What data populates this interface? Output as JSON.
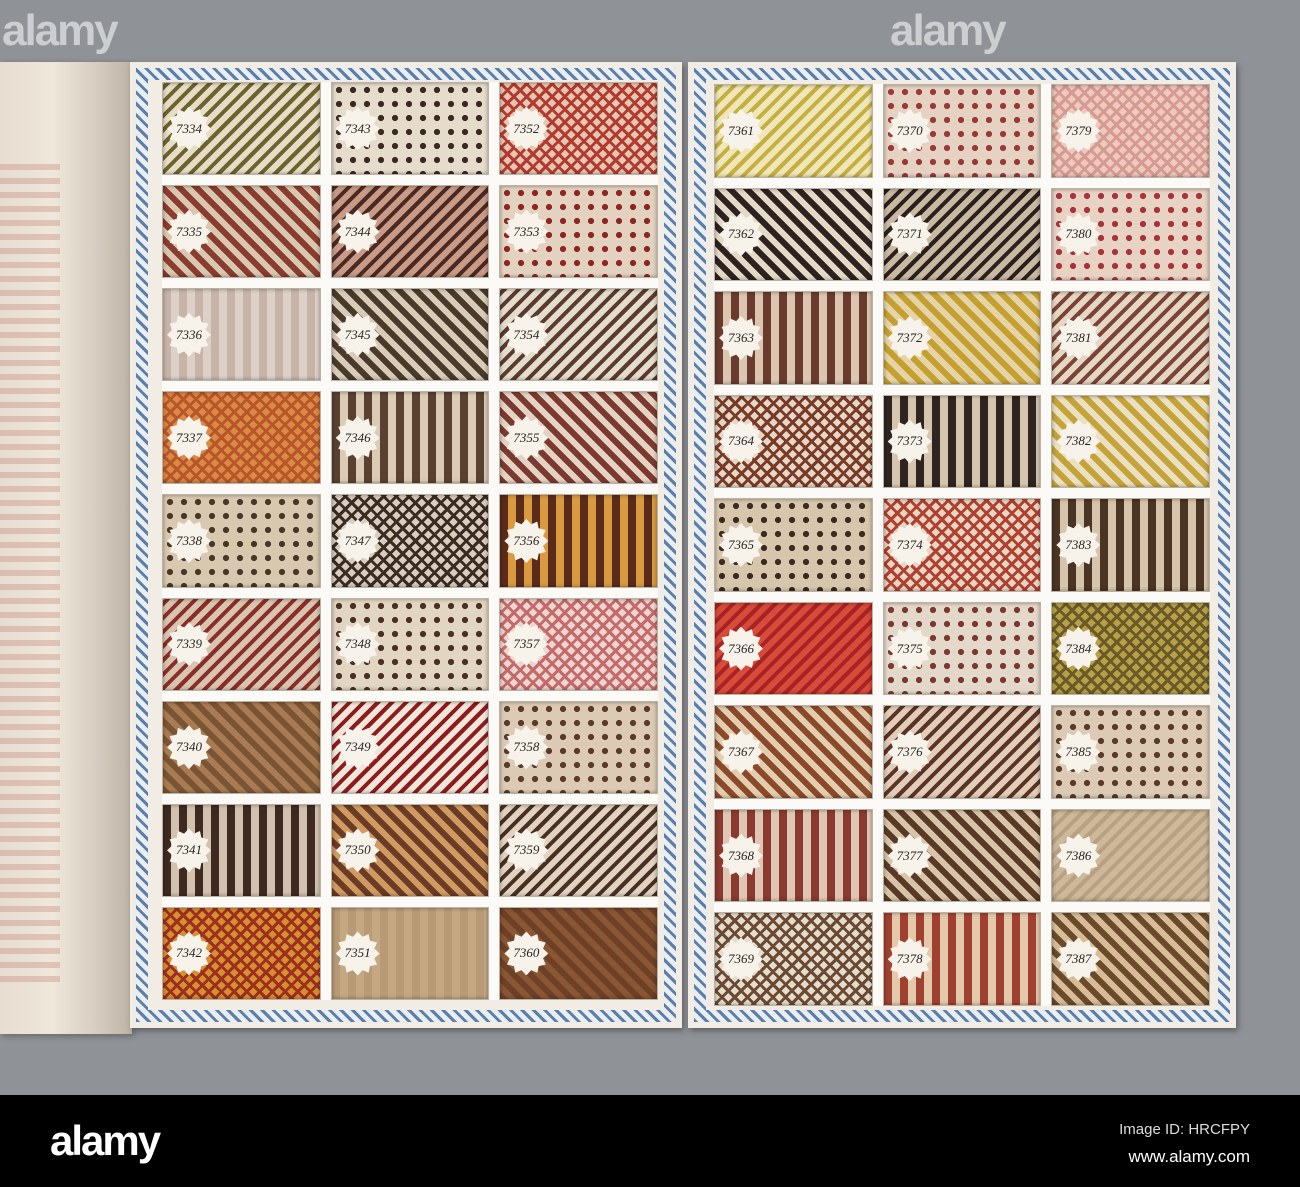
{
  "watermarks": [
    "alamy",
    "alamy"
  ],
  "left_page": {
    "numbers": [
      "7334",
      "7335",
      "7336",
      "7337",
      "7338",
      "7339",
      "7340",
      "7341",
      "7342",
      "7343",
      "7344",
      "7345",
      "7346",
      "7347",
      "7348",
      "7349",
      "7350",
      "7351",
      "7352",
      "7353",
      "7354",
      "7355",
      "7356",
      "7357",
      "7358",
      "7359",
      "7360"
    ],
    "colors": [
      [
        "#6b6330",
        "#e8dcc4"
      ],
      [
        "#8a3c2e",
        "#d9c7b0"
      ],
      [
        "#c8b3a8",
        "#ddd0c6"
      ],
      [
        "#b8562a",
        "#d98a45"
      ],
      [
        "#4a3626",
        "#d8c8b0"
      ],
      [
        "#8a2f28",
        "#d9c4b2"
      ],
      [
        "#7a5533",
        "#a87b52"
      ],
      [
        "#3e2a20",
        "#d2c1ac"
      ],
      [
        "#9c2f20",
        "#d6902e"
      ],
      [
        "#3a2a22",
        "#e6dccb"
      ],
      [
        "#4a2a22",
        "#c99a86"
      ],
      [
        "#4a3a2c",
        "#d8cbb8"
      ],
      [
        "#5a4030",
        "#d9cbb4"
      ],
      [
        "#3a2c24",
        "#d9cdbc"
      ],
      [
        "#4a3024",
        "#e2d6c2"
      ],
      [
        "#8e1c1e",
        "#f0e6da"
      ],
      [
        "#6a3c24",
        "#d09a62"
      ],
      [
        "#b89a76",
        "#c4a882"
      ],
      [
        "#b33a30",
        "#e6c8b2"
      ],
      [
        "#8e2622",
        "#e3d2c0"
      ],
      [
        "#5a3c2e",
        "#e4dccd"
      ],
      [
        "#7a3a30",
        "#e6d2c2"
      ],
      [
        "#5a2a1a",
        "#d99a40"
      ],
      [
        "#c46a6a",
        "#eed6d0"
      ],
      [
        "#5a3a2a",
        "#dccab4"
      ],
      [
        "#4a3024",
        "#e0d4c0"
      ],
      [
        "#6e4026",
        "#8a5634"
      ]
    ]
  },
  "right_page": {
    "numbers": [
      "7361",
      "7362",
      "7363",
      "7364",
      "7365",
      "7366",
      "7367",
      "7368",
      "7369",
      "7370",
      "7371",
      "7372",
      "7373",
      "7374",
      "7375",
      "7376",
      "7377",
      "7378",
      "7379",
      "7380",
      "7381",
      "7382",
      "7383",
      "7384",
      "7385",
      "7386",
      "7387"
    ],
    "colors": [
      [
        "#c4b040",
        "#f0e6b8"
      ],
      [
        "#2e2220",
        "#e4d8c6"
      ],
      [
        "#6a3a2e",
        "#dcc6b0"
      ],
      [
        "#7a3a28",
        "#e6d8c6"
      ],
      [
        "#3a2a20",
        "#d8c6ac"
      ],
      [
        "#a82424",
        "#d84a3a"
      ],
      [
        "#8a4a2a",
        "#e4ccae"
      ],
      [
        "#8a3a2e",
        "#e0c6b4"
      ],
      [
        "#6a4a34",
        "#e6dccb"
      ],
      [
        "#9a3a36",
        "#e6d2c2"
      ],
      [
        "#2a201c",
        "#c9b8a2"
      ],
      [
        "#c4a030",
        "#e6d4a8"
      ],
      [
        "#2e2420",
        "#d6c6b0"
      ],
      [
        "#b04030",
        "#e8d6c4"
      ],
      [
        "#7a3a30",
        "#e4d8ca"
      ],
      [
        "#5a3428",
        "#e2cdb8"
      ],
      [
        "#5a3a26",
        "#d8c4a8"
      ],
      [
        "#a04030",
        "#e4c8aa"
      ],
      [
        "#d49c90",
        "#f0c8c0"
      ],
      [
        "#a8343a",
        "#e8d2c4"
      ],
      [
        "#7a4436",
        "#e6d6c4"
      ],
      [
        "#c4a43a",
        "#ece0c2"
      ],
      [
        "#4a3424",
        "#d6c4ac"
      ],
      [
        "#6a5a26",
        "#b8a04a"
      ],
      [
        "#5a3a2a",
        "#dccab4"
      ],
      [
        "#b8a082",
        "#cdb89a"
      ],
      [
        "#6a4a2a",
        "#d8bc98"
      ]
    ]
  },
  "footer": {
    "logo": "alamy",
    "image_id": "Image ID: HRCFPY",
    "url": "www.alamy.com"
  }
}
